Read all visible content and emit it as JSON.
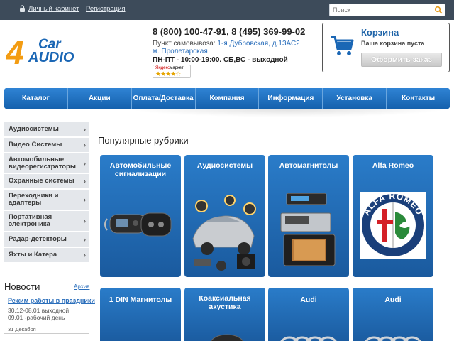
{
  "topbar": {
    "account_label": "Личный кабинет",
    "register_label": "Регистрация",
    "search_placeholder": "Поиск"
  },
  "header": {
    "logo_text_top": "Car",
    "logo_text_bottom": "AUDIO",
    "logo_digit": "4",
    "phones": "8 (800) 100-47-91, 8 (495) 369-99-02",
    "pickup_label": "Пункт самовывоза: ",
    "pickup_address": "1-я Дубровская, д.13АС2 м. Пролетарская",
    "hours": "ПН-ПТ - 10:00-19:00. СБ,ВС - выходной",
    "ymarket_brand_a": "Яндекс",
    "ymarket_brand_b": "маркет",
    "ymarket_rating": 4
  },
  "cart": {
    "title": "Корзина",
    "status": "Ваша корзина пуста",
    "checkout_label": "Оформить заказ"
  },
  "nav": [
    "Каталог",
    "Акции",
    "Оплата/Доставка",
    "Компания",
    "Информация",
    "Установка",
    "Контакты"
  ],
  "sidebar": [
    "Аудиосистемы",
    "Видео Системы",
    "Автомобильные видеорегистраторы",
    "Охранные системы",
    "Переходники и адаптеры",
    "Портативная электроника",
    "Радар-детекторы",
    "Яхты и Катера"
  ],
  "news": {
    "heading": "Новости",
    "archive_label": "Архив",
    "item_title": "Режим работы в праздники",
    "item_body_1": "30.12-08.01 выходной",
    "item_body_2": "09.01 -рабочий день",
    "date": "31 Декабря"
  },
  "main": {
    "section_title": "Популярные рубрики",
    "tiles_row1": [
      "Автомобильные сигнализации",
      "Аудиосистемы",
      "Автомагнитолы",
      "Alfa Romeo"
    ],
    "tiles_row2": [
      "1 DIN Магнитолы",
      "Коаксиальная акустика",
      "Audi",
      "Audi"
    ],
    "alfa_ring_text": "ALFA ROMEO"
  },
  "colors": {
    "accent_blue": "#1f64a8",
    "nav_blue": "#2f83d4",
    "topbar": "#3d4b5a",
    "logo_orange": "#f39c12"
  }
}
